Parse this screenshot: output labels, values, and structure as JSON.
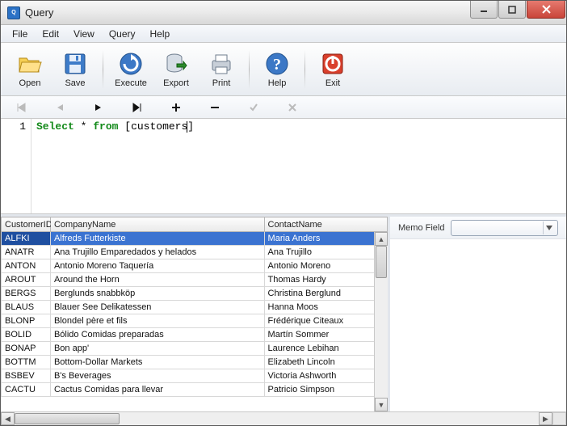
{
  "window": {
    "title": "Query"
  },
  "menu": {
    "items": [
      "File",
      "Edit",
      "View",
      "Query",
      "Help"
    ]
  },
  "toolbar": {
    "open": "Open",
    "save": "Save",
    "execute": "Execute",
    "export": "Export",
    "print": "Print",
    "help": "Help",
    "exit": "Exit"
  },
  "nav": {
    "first": "⏮",
    "prev": "◀",
    "play": "▶",
    "next": "⏭",
    "plus": "+",
    "minus": "−",
    "check": "✓",
    "x": "✕"
  },
  "editor": {
    "line_no": "1",
    "kw_select": "Select",
    "star": " * ",
    "kw_from": "from",
    "sp": " ",
    "lbr": "[",
    "ident": "customers",
    "rbr": "]"
  },
  "grid": {
    "columns": [
      "CustomerID",
      "CompanyName",
      "ContactName"
    ],
    "rows": [
      {
        "id": "ALFKI",
        "cn": "Alfreds Futterkiste",
        "ct": "Maria Anders",
        "sel": true
      },
      {
        "id": "ANATR",
        "cn": "Ana Trujillo Emparedados y helados",
        "ct": "Ana Trujillo"
      },
      {
        "id": "ANTON",
        "cn": "Antonio Moreno Taquería",
        "ct": "Antonio Moreno"
      },
      {
        "id": "AROUT",
        "cn": "Around the Horn",
        "ct": "Thomas Hardy"
      },
      {
        "id": "BERGS",
        "cn": "Berglunds snabbköp",
        "ct": "Christina Berglund"
      },
      {
        "id": "BLAUS",
        "cn": "Blauer See Delikatessen",
        "ct": "Hanna Moos"
      },
      {
        "id": "BLONP",
        "cn": "Blondel père et fils",
        "ct": "Frédérique Citeaux"
      },
      {
        "id": "BOLID",
        "cn": "Bólido Comidas preparadas",
        "ct": "Martín Sommer"
      },
      {
        "id": "BONAP",
        "cn": "Bon app'",
        "ct": "Laurence Lebihan"
      },
      {
        "id": "BOTTM",
        "cn": "Bottom-Dollar Markets",
        "ct": "Elizabeth Lincoln"
      },
      {
        "id": "BSBEV",
        "cn": "B's Beverages",
        "ct": "Victoria Ashworth"
      },
      {
        "id": "CACTU",
        "cn": "Cactus Comidas para llevar",
        "ct": "Patricio Simpson"
      }
    ]
  },
  "memo": {
    "label": "Memo Field"
  }
}
